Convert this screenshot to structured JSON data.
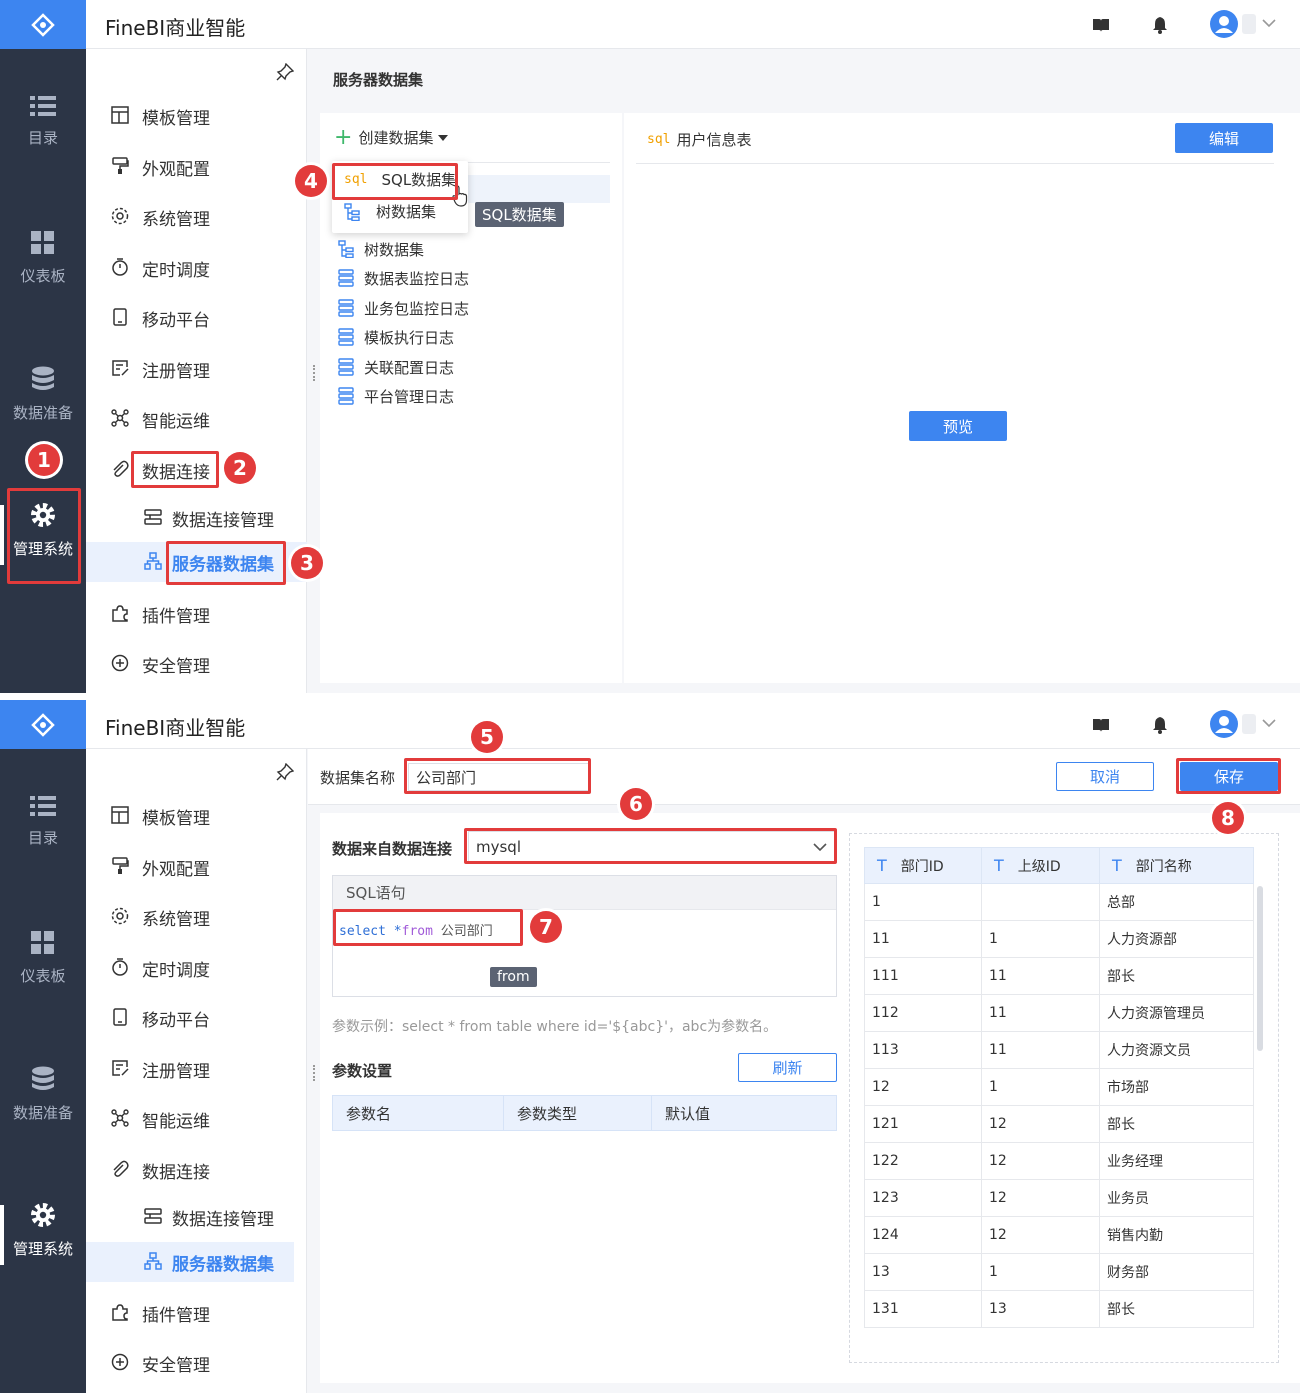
{
  "app": {
    "brand": "FineBI商业智能"
  },
  "rail": {
    "items": [
      {
        "label": "目录",
        "icon": "list-icon"
      },
      {
        "label": "仪表板",
        "icon": "grid-icon"
      },
      {
        "label": "数据准备",
        "icon": "database-icon"
      },
      {
        "label": "管理系统",
        "icon": "gear-icon"
      }
    ]
  },
  "menu": {
    "items": [
      {
        "label": "模板管理",
        "icon": "template-icon"
      },
      {
        "label": "外观配置",
        "icon": "brush-icon"
      },
      {
        "label": "系统管理",
        "icon": "settings-icon"
      },
      {
        "label": "定时调度",
        "icon": "timer-icon"
      },
      {
        "label": "移动平台",
        "icon": "mobile-icon"
      },
      {
        "label": "注册管理",
        "icon": "register-icon"
      },
      {
        "label": "智能运维",
        "icon": "ops-icon"
      },
      {
        "label": "数据连接",
        "icon": "paperclip-icon"
      },
      {
        "label": "数据连接管理",
        "icon": "connection-icon"
      },
      {
        "label": "服务器数据集",
        "icon": "dataset-icon"
      },
      {
        "label": "插件管理",
        "icon": "plugin-icon"
      },
      {
        "label": "安全管理",
        "icon": "shield-icon"
      }
    ]
  },
  "panel1": {
    "title": "服务器数据集",
    "create_label": "创建数据集",
    "popup": {
      "sql_prefix": "sql",
      "sql_label": "SQL数据集",
      "tree_label": "树数据集"
    },
    "tooltip": "SQL数据集",
    "tree": [
      "树数据集",
      "数据表监控日志",
      "业务包监控日志",
      "模板执行日志",
      "关联配置日志",
      "平台管理日志"
    ],
    "selected_prefix": "sql",
    "selected_name": "用户信息表",
    "edit_label": "编辑",
    "preview_label": "预览"
  },
  "panel2": {
    "name_label": "数据集名称",
    "name_value": "公司部门",
    "cancel_label": "取消",
    "save_label": "保存",
    "source_label": "数据来自数据连接",
    "source_value": "mysql",
    "sql_title": "SQL语句",
    "sql": {
      "select": "select",
      "star": " *",
      "from": "from",
      "table": " 公司部门"
    },
    "autocomplete": "from",
    "hint": "参数示例：select * from table where id='${abc}'，abc为参数名。",
    "param_title": "参数设置",
    "refresh_label": "刷新",
    "param_cols": [
      "参数名",
      "参数类型",
      "默认值"
    ],
    "preview_cols": [
      "部门ID",
      "上级ID",
      "部门名称"
    ],
    "preview_col_type": "T",
    "rows": [
      [
        "1",
        "",
        "总部"
      ],
      [
        "11",
        "1",
        "人力资源部"
      ],
      [
        "111",
        "11",
        "部长"
      ],
      [
        "112",
        "11",
        "人力资源管理员"
      ],
      [
        "113",
        "11",
        "人力资源文员"
      ],
      [
        "12",
        "1",
        "市场部"
      ],
      [
        "121",
        "12",
        "部长"
      ],
      [
        "122",
        "12",
        "业务经理"
      ],
      [
        "123",
        "12",
        "业务员"
      ],
      [
        "124",
        "12",
        "销售内勤"
      ],
      [
        "13",
        "1",
        "财务部"
      ],
      [
        "131",
        "13",
        "部长"
      ]
    ]
  },
  "badges": [
    "1",
    "2",
    "3",
    "4",
    "5",
    "6",
    "7",
    "8"
  ],
  "colors": {
    "accent": "#3d85f0",
    "rail": "#2c3546",
    "annotation": "#e23b3b"
  }
}
